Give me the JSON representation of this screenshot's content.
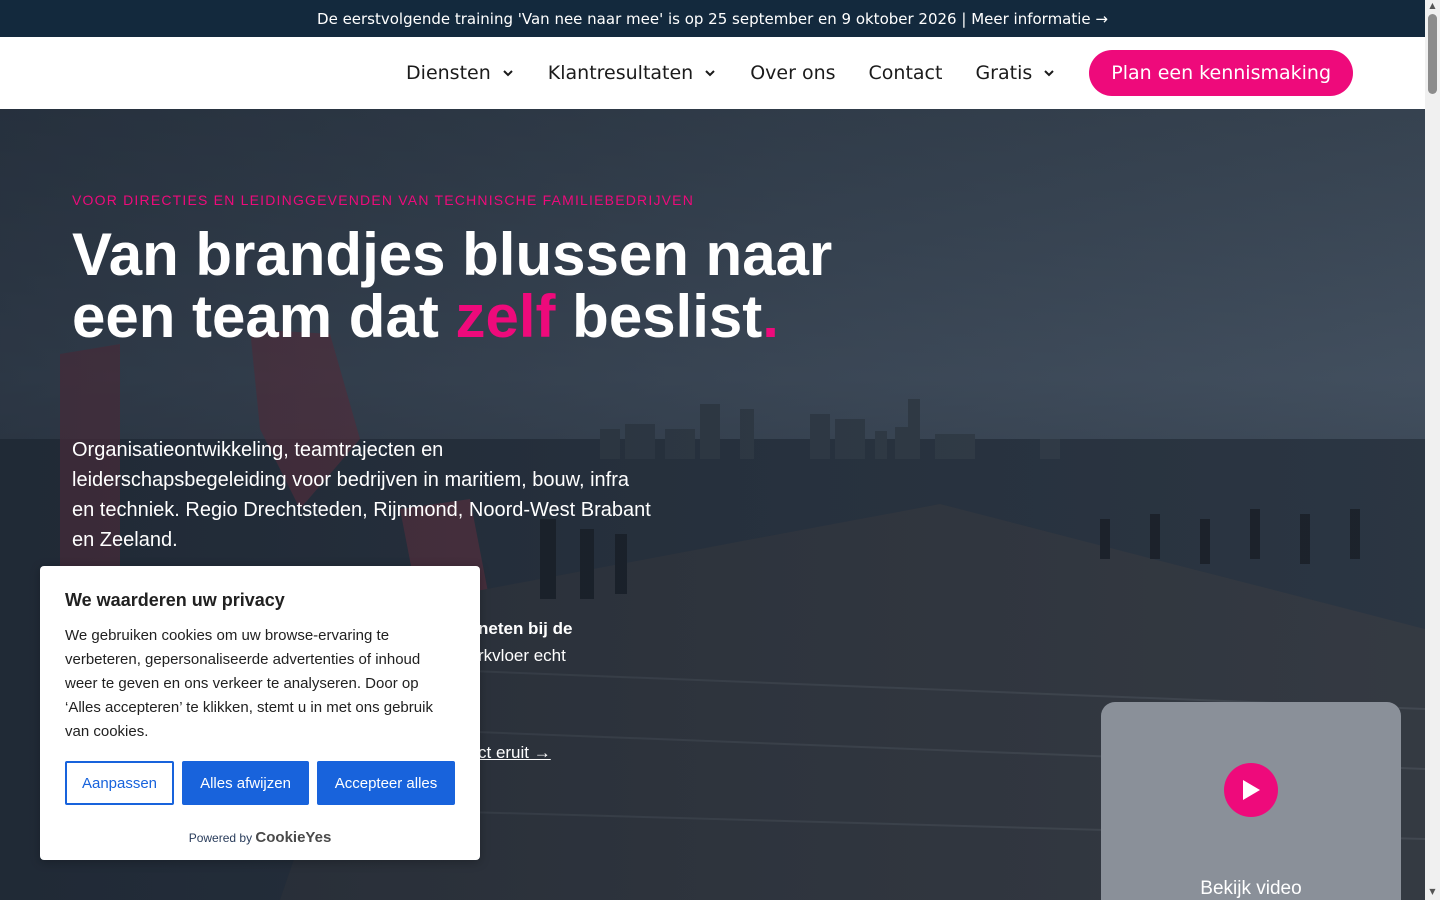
{
  "topbar": {
    "announcement": "De eerstvolgende training 'Van nee naar mee' is op 25 september en 9 oktober 2026 | Meer informatie →"
  },
  "nav": {
    "items": [
      {
        "label": "Diensten",
        "dropdown": true
      },
      {
        "label": "Klantresultaten",
        "dropdown": true
      },
      {
        "label": "Over ons",
        "dropdown": false
      },
      {
        "label": "Contact",
        "dropdown": false
      },
      {
        "label": "Gratis",
        "dropdown": true
      }
    ],
    "cta_label": "Plan een kennismaking"
  },
  "hero": {
    "eyebrow": "VOOR DIRECTIES EN LEIDINGGEVENDEN VAN TECHNISCHE FAMILIEBEDRIJVEN",
    "headline_part1": "Van brandjes blussen naar",
    "headline_part2": "een team dat ",
    "headline_highlight": "zelf",
    "headline_part3": " beslist",
    "headline_dot": ".",
    "lead": "Organisatieontwikkeling, teamtrajecten en leiderschapsbegeleiding voor bedrijven in maritiem, bouw, infra en techniek. Regio Drechtsteden, Rijnmond, Noord-West Brabant en Zeeland.",
    "partial_bold": "neten bij de",
    "partial_text": "rkvloer echt",
    "partial_link": "ct eruit →"
  },
  "video": {
    "label": "Bekijk video"
  },
  "cookie": {
    "title": "We waarderen uw privacy",
    "body": "We gebruiken cookies om uw browse-ervaring te verbeteren, gepersonaliseerde advertenties of inhoud weer te geven en ons verkeer te analyseren. Door op ‘Alles accepteren’ te klikken, stemt u in met ons gebruik van cookies.",
    "btn_customize": "Aanpassen",
    "btn_reject": "Alles afwijzen",
    "btn_accept": "Accepteer alles",
    "powered_by": "Powered by",
    "brand": "CookieYes"
  },
  "colors": {
    "accent": "#ee0a7b",
    "topbar": "#13293d",
    "cookie_blue": "#1863dc"
  }
}
